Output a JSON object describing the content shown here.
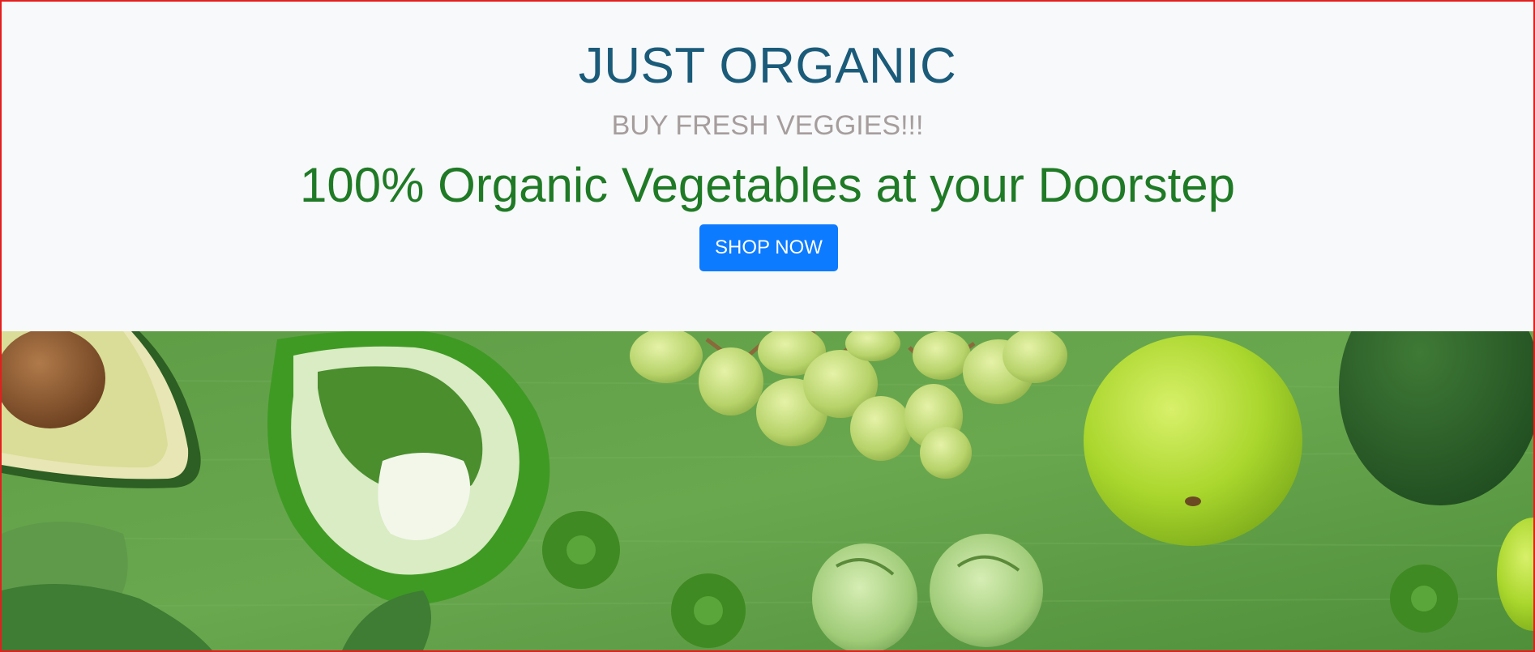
{
  "hero": {
    "brand": "JUST ORGANIC",
    "tagline": "BUY FRESH VEGGIES!!!",
    "headline": "100% Organic Vegetables at your Doorstep",
    "shop_button_label": "SHOP NOW"
  },
  "colors": {
    "brand": "#1b5b7a",
    "tagline": "#a69d9d",
    "headline": "#1f7a26",
    "button": "#0d7bff",
    "hero_background": "#f8f9fa",
    "frame_border": "#e41e1e"
  },
  "banner": {
    "image_subjects": [
      "avocado-half",
      "green-bell-pepper",
      "green-grapes",
      "green-apple",
      "whole-avocado",
      "brussels-sprouts",
      "green-chrysanthemums",
      "spinach-leaves"
    ]
  }
}
